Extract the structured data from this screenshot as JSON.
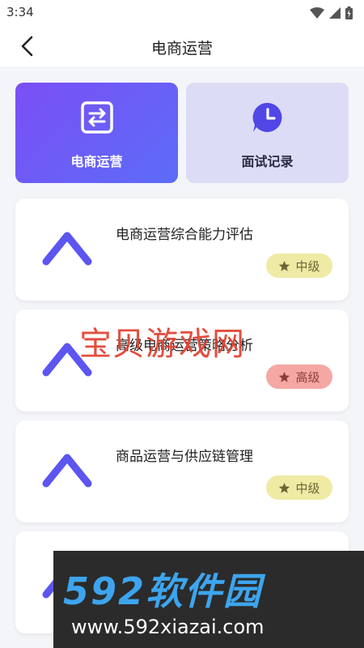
{
  "status": {
    "time": "3:34"
  },
  "nav": {
    "title": "电商运营"
  },
  "tabs": [
    {
      "label": "电商运营",
      "icon": "swap-arrows-icon"
    },
    {
      "label": "面试记录",
      "icon": "clock-chat-icon"
    }
  ],
  "courses": [
    {
      "title": "电商运营综合能力评估",
      "level": "中级"
    },
    {
      "title": "高级电商运营策略分析",
      "level": "高级"
    },
    {
      "title": "商品运营与供应链管理",
      "level": "中级"
    },
    {
      "title": "",
      "level": ""
    }
  ],
  "watermark": {
    "text": "宝贝游戏网"
  },
  "banner": {
    "logo": "592软件园",
    "url": "www.592xiazai.com"
  },
  "colors": {
    "accent": "#5c6cf8",
    "badge_mid": "#efeaa4",
    "badge_high": "#f5a8a3",
    "watermark": "#e2402f",
    "banner_logo": "#3da5ee"
  }
}
